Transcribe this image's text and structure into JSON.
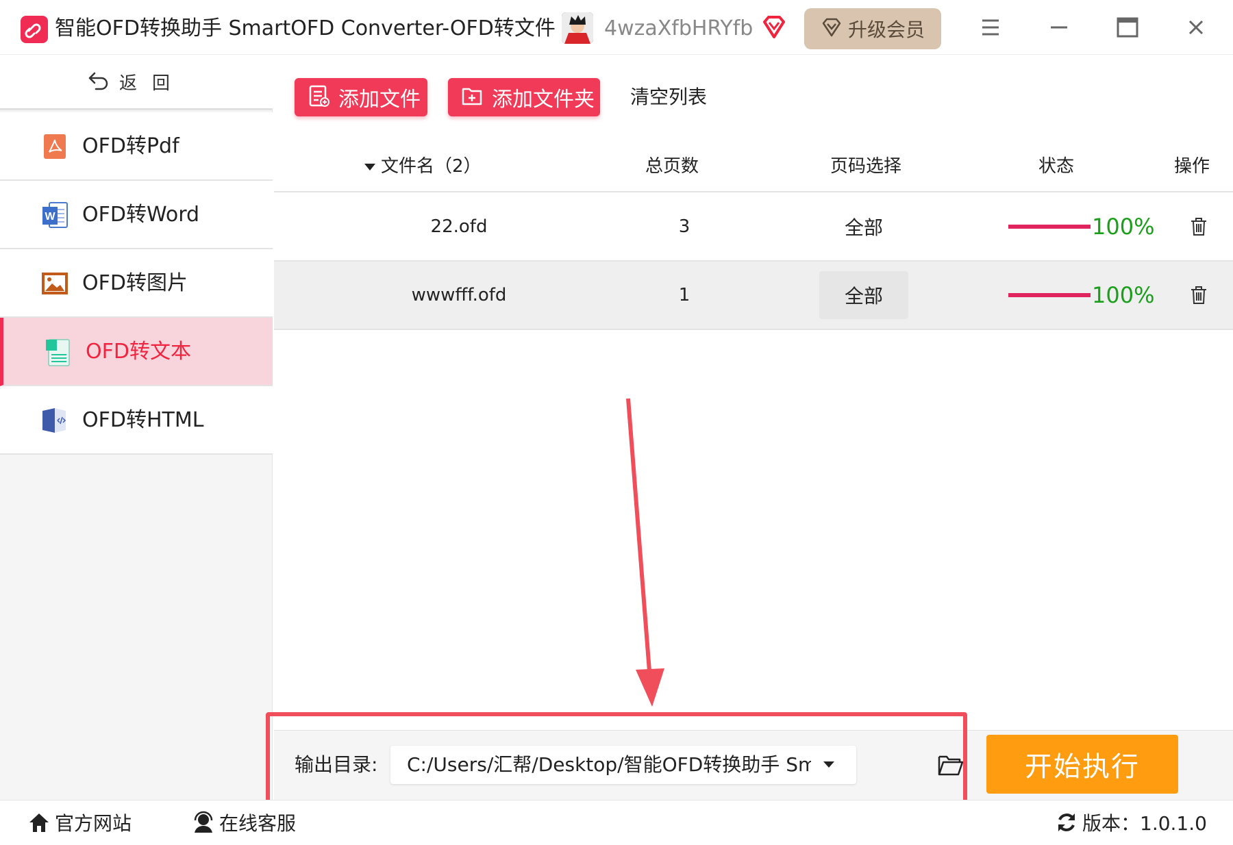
{
  "titlebar": {
    "title": "智能OFD转换助手 SmartOFD Converter-OFD转文件",
    "username": "4wzaXfbHRYfb",
    "upgrade_label": "升级会员"
  },
  "sidebar": {
    "back_label": "返回",
    "items": [
      {
        "label": "OFD转Pdf",
        "icon": "pdf-icon",
        "active": false
      },
      {
        "label": "OFD转Word",
        "icon": "word-icon",
        "active": false
      },
      {
        "label": "OFD转图片",
        "icon": "image-icon",
        "active": false
      },
      {
        "label": "OFD转文本",
        "icon": "text-icon",
        "active": true
      },
      {
        "label": "OFD转HTML",
        "icon": "html-icon",
        "active": false
      }
    ]
  },
  "toolbar": {
    "add_file_label": "添加文件",
    "add_folder_label": "添加文件夹",
    "clear_list_label": "清空列表"
  },
  "table": {
    "columns": {
      "filename": "文件名（2）",
      "pages": "总页数",
      "range": "页码选择",
      "status": "状态",
      "action": "操作"
    },
    "rows": [
      {
        "name": "22.ofd",
        "pages": "3",
        "range": "全部",
        "progress": 100,
        "status": "100%"
      },
      {
        "name": "wwwfff.ofd",
        "pages": "1",
        "range": "全部",
        "progress": 100,
        "status": "100%"
      }
    ]
  },
  "output": {
    "label": "输出目录:",
    "path": "C:/Users/汇帮/Desktop/智能OFD转换助手 SmartOFD",
    "start_label": "开始执行"
  },
  "statusbar": {
    "website_label": "官方网站",
    "support_label": "在线客服",
    "version_label": "版本：1.0.1.0"
  },
  "colors": {
    "accent": "#f02b54",
    "start_button": "#ff9c0f",
    "progress": "#e0245e",
    "status_text": "#1b9e1b",
    "active_nav_bg": "#f8d4dc",
    "annotation": "#f04e5a"
  }
}
